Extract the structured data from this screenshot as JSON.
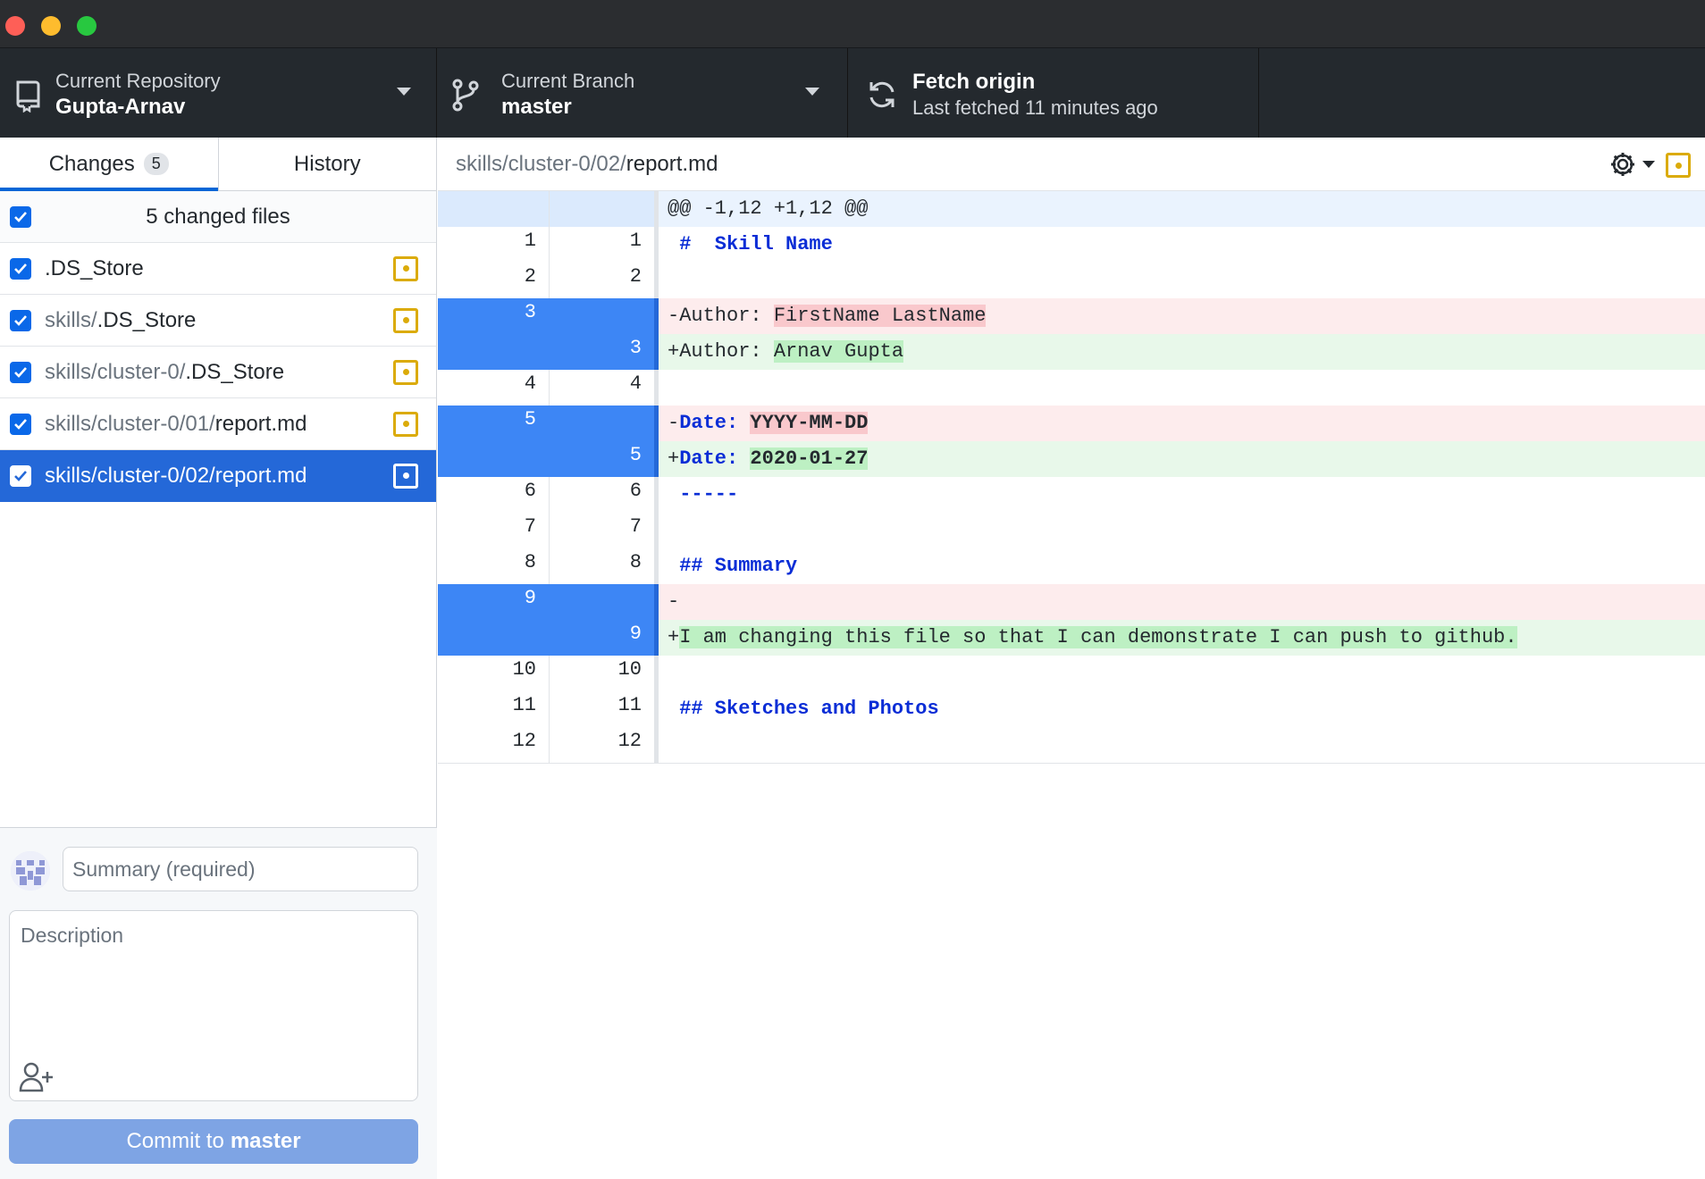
{
  "toolbar": {
    "repo_label": "Current Repository",
    "repo_value": "Gupta-Arnav",
    "branch_label": "Current Branch",
    "branch_value": "master",
    "fetch_title": "Fetch origin",
    "fetch_sub": "Last fetched 11 minutes ago"
  },
  "tabs": {
    "changes": "Changes",
    "changes_count": "5",
    "history": "History"
  },
  "changes": {
    "header": "5 changed files",
    "files": [
      {
        "dir": "",
        "name": ".DS_Store"
      },
      {
        "dir": "skills/",
        "name": ".DS_Store"
      },
      {
        "dir": "skills/cluster-0/",
        "name": ".DS_Store"
      },
      {
        "dir": "skills/cluster-0/01/",
        "name": "report.md"
      },
      {
        "dir": "skills/cluster-0/02/",
        "name": "report.md"
      }
    ]
  },
  "commit": {
    "summary_placeholder": "Summary (required)",
    "description_placeholder": "Description",
    "button_prefix": "Commit to",
    "button_branch": "master"
  },
  "diff": {
    "path_dir": "skills/cluster-0/02/",
    "path_file": "report.md",
    "hunk": "@@ -1,12 +1,12 @@",
    "lines": [
      {
        "old": "1",
        "new": "1",
        "text": " #  Skill Name"
      },
      {
        "old": "2",
        "new": "2",
        "text": ""
      },
      {
        "old": "3",
        "new": "",
        "prefix": "-Author: ",
        "hl": "FirstName LastName"
      },
      {
        "old": "",
        "new": "3",
        "prefix": "+Author: ",
        "hl": "Arnav Gupta"
      },
      {
        "old": "4",
        "new": "4",
        "text": ""
      },
      {
        "old": "5",
        "new": "",
        "sign": "-",
        "key": "Date:",
        "hl": "YYYY-MM-DD"
      },
      {
        "old": "",
        "new": "5",
        "sign": "+",
        "key": "Date:",
        "hl": "2020-01-27"
      },
      {
        "old": "6",
        "new": "6",
        "text": " -----"
      },
      {
        "old": "7",
        "new": "7",
        "text": ""
      },
      {
        "old": "8",
        "new": "8",
        "text": " ## Summary"
      },
      {
        "old": "9",
        "new": "",
        "text": "-"
      },
      {
        "old": "",
        "new": "9",
        "sign": "+",
        "hl": "I am changing this file so that I can demonstrate I can push to github."
      },
      {
        "old": "10",
        "new": "10",
        "text": ""
      },
      {
        "old": "11",
        "new": "11",
        "text": " ## Sketches and Photos"
      },
      {
        "old": "12",
        "new": "12",
        "text": ""
      }
    ]
  },
  "colors": {
    "accent": "#2468d8",
    "modified": "#dbab09",
    "deleted_bg": "#fdeced",
    "added_bg": "#e8f8ea"
  }
}
